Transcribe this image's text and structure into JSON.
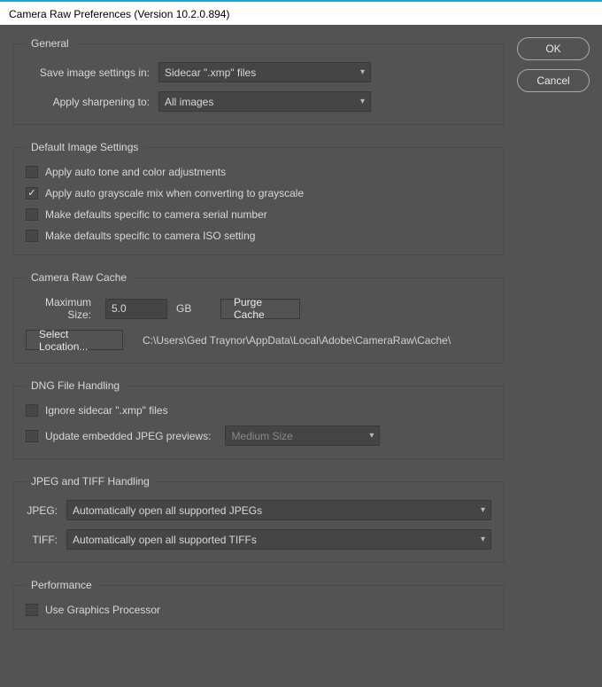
{
  "titlebar": "Camera Raw Preferences  (Version 10.2.0.894)",
  "buttons": {
    "ok": "OK",
    "cancel": "Cancel"
  },
  "general": {
    "legend": "General",
    "save_label": "Save image settings in:",
    "save_value": "Sidecar \".xmp\" files",
    "sharpen_label": "Apply sharpening to:",
    "sharpen_value": "All images"
  },
  "defaults": {
    "legend": "Default Image Settings",
    "auto_tone": {
      "checked": false,
      "label": "Apply auto tone and color adjustments"
    },
    "auto_gray": {
      "checked": true,
      "label": "Apply auto grayscale mix when converting to grayscale"
    },
    "serial": {
      "checked": false,
      "label": "Make defaults specific to camera serial number"
    },
    "iso": {
      "checked": false,
      "label": "Make defaults specific to camera ISO setting"
    }
  },
  "cache": {
    "legend": "Camera Raw Cache",
    "max_label": "Maximum Size:",
    "max_value": "5.0",
    "unit": "GB",
    "purge": "Purge Cache",
    "select_loc": "Select Location...",
    "path": "C:\\Users\\Ged Traynor\\AppData\\Local\\Adobe\\CameraRaw\\Cache\\"
  },
  "dng": {
    "legend": "DNG File Handling",
    "ignore": {
      "checked": false,
      "label": "Ignore sidecar \".xmp\" files"
    },
    "update_label": "Update embedded JPEG previews:",
    "update_checked": false,
    "update_value": "Medium Size"
  },
  "jt": {
    "legend": "JPEG and TIFF Handling",
    "jpeg_label": "JPEG:",
    "jpeg_value": "Automatically open all supported JPEGs",
    "tiff_label": "TIFF:",
    "tiff_value": "Automatically open all supported TIFFs"
  },
  "perf": {
    "legend": "Performance",
    "gpu": {
      "checked": false,
      "label": "Use Graphics Processor"
    }
  }
}
